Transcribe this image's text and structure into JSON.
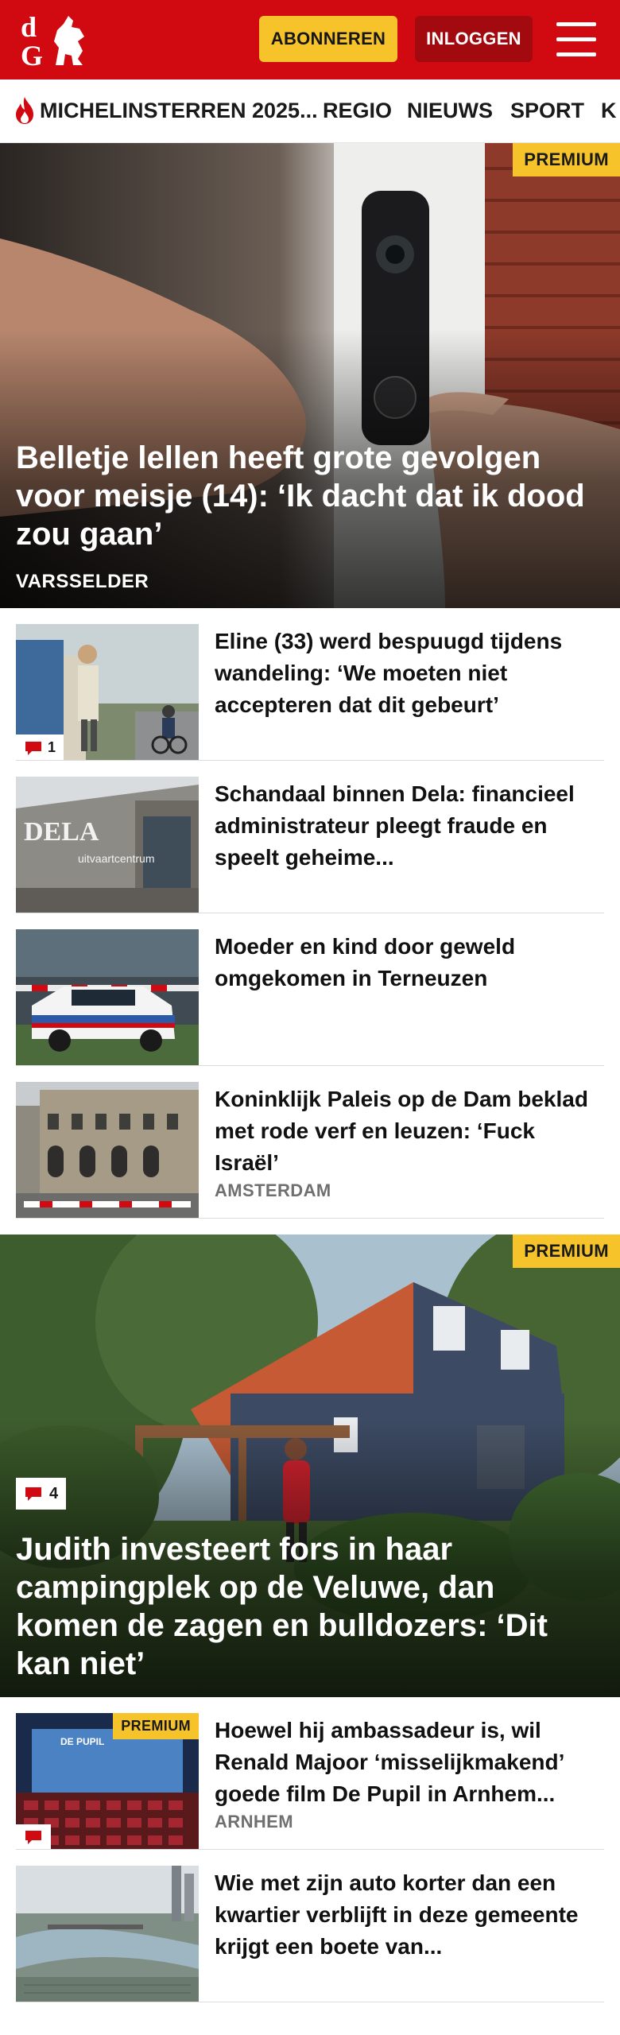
{
  "header": {
    "logo_text": "dG",
    "subscribe_label": "ABONNEREN",
    "login_label": "INLOGGEN",
    "brand_color": "#d10a11",
    "accent_color": "#f6c32b",
    "menu_icon": "hamburger-icon"
  },
  "nav": {
    "items": [
      {
        "label": "MICHELINSTERREN 2025...",
        "icon": "flame-icon"
      },
      {
        "label": "REGIO"
      },
      {
        "label": "NIEUWS"
      },
      {
        "label": "SPORT"
      },
      {
        "label": "K"
      }
    ]
  },
  "articles": {
    "hero1": {
      "badge": "PREMIUM",
      "title": "Belletje lellen heeft grote gevolgen voor meisje (14): ‘Ik dacht dat ik dood zou gaan’",
      "location": "VARSSELDER"
    },
    "list1": [
      {
        "title": "Eline (33) werd bespuugd tijdens wandeling: ‘We moeten niet accepteren dat dit gebeurt’",
        "comments": "1"
      },
      {
        "title": "Schandaal binnen Dela: financieel administrateur pleegt fraude en speelt geheime...",
        "thumb_text": "DELA",
        "thumb_subtext": "uitvaartcentrum"
      },
      {
        "title": "Moeder en kind door geweld omgekomen in Terneuzen"
      },
      {
        "title": "Koninklijk Paleis op de Dam beklad met rode verf en leuzen: ‘Fuck Israël’",
        "location": "AMSTERDAM"
      }
    ],
    "hero2": {
      "badge": "PREMIUM",
      "comments": "4",
      "title": "Judith investeert fors in haar campingplek op de Veluwe, dan komen de zagen en bulldozers: ‘Dit kan niet’"
    },
    "list2": [
      {
        "title": "Hoewel hij ambassadeur is, wil Renald Majoor ‘misselijkmakend’ goede film De Pupil in Arnhem...",
        "location": "ARNHEM",
        "badge": "PREMIUM",
        "thumb_text": "DE PUPIL"
      },
      {
        "title": "Wie met zijn auto korter dan een kwartier verblijft in deze gemeente krijgt een boete van..."
      }
    ]
  }
}
